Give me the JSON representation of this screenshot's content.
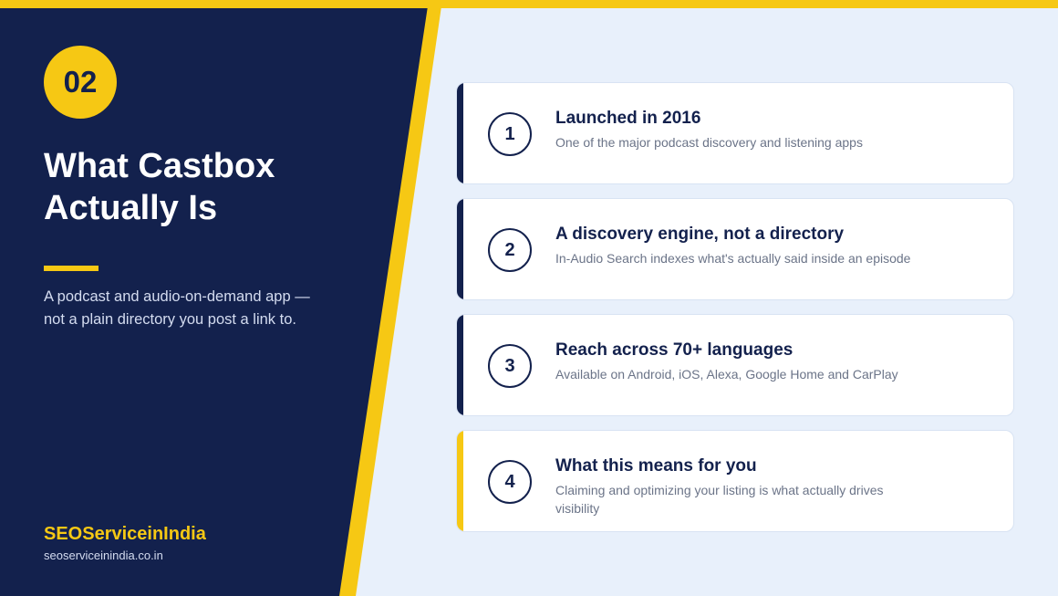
{
  "colors": {
    "navy": "#13214d",
    "accent": "#f6c814",
    "background": "#e8f0fb",
    "card": "#ffffff"
  },
  "slide": {
    "number": "02",
    "title_line1": "What Castbox",
    "title_line2": "Actually Is",
    "subtitle": "A podcast and audio-on-demand app — not a plain directory you post a link to."
  },
  "brand": {
    "name": "SEOServiceinIndia",
    "url": "seoserviceinindia.co.in"
  },
  "cards": [
    {
      "number": "1",
      "title": "Launched in 2016",
      "description": "One of the major podcast discovery and listening apps"
    },
    {
      "number": "2",
      "title": "A discovery engine, not a directory",
      "description": "In-Audio Search indexes what's actually said inside an episode"
    },
    {
      "number": "3",
      "title": "Reach across 70+ languages",
      "description": "Available on Android, iOS, Alexa, Google Home and CarPlay"
    },
    {
      "number": "4",
      "title": "What this means for you",
      "description": "Claiming and optimizing your listing is what actually drives visibility"
    }
  ]
}
